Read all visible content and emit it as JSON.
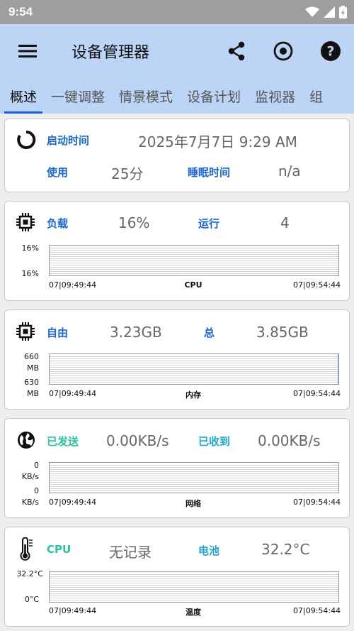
{
  "status": {
    "time": "9:54"
  },
  "app": {
    "title": "设备管理器"
  },
  "tabs": [
    {
      "label": "概述",
      "active": true
    },
    {
      "label": "一键调整"
    },
    {
      "label": "情景模式"
    },
    {
      "label": "设备计划"
    },
    {
      "label": "监视器"
    },
    {
      "label": "组"
    }
  ],
  "uptime": {
    "boot_label": "启动时间",
    "boot_value": "2025年7月7日 9:29 AM",
    "used_label": "使用",
    "used_value": "25分",
    "sleep_label": "睡眠时间",
    "sleep_value": "n/a"
  },
  "cpu": {
    "load_label": "负载",
    "load_value": "16%",
    "run_label": "运行",
    "run_value": "4",
    "axis_top": "16%",
    "axis_bottom": "16%",
    "time_start": "07|09:49:44",
    "time_end": "07|09:54:44",
    "chart_name": "CPU"
  },
  "memory": {
    "free_label": "自由",
    "free_value": "3.23GB",
    "total_label": "总",
    "total_value": "3.85GB",
    "axis_top": "660\nMB",
    "axis_bottom": "630\nMB",
    "time_start": "07|09:49:44",
    "time_end": "07|09:54:44",
    "chart_name": "内存"
  },
  "network": {
    "sent_label": "已发送",
    "sent_value": "0.00KB/s",
    "recv_label": "已收到",
    "recv_value": "0.00KB/s",
    "axis_top": "0\nKB/s",
    "axis_bottom": "0\nKB/s",
    "time_start": "07|09:49:44",
    "time_end": "07|09:54:44",
    "chart_name": "网络"
  },
  "temperature": {
    "cpu_label": "CPU",
    "cpu_value": "无记录",
    "battery_label": "电池",
    "battery_value": "32.2°C",
    "axis_top": "32.2°C",
    "axis_bottom": "0°C",
    "time_start": "07|09:49:44",
    "time_end": "07|09:54:44",
    "chart_name": "温度"
  },
  "colors": {
    "app_bar": "#bcd5f6",
    "accent": "#1a66d0",
    "green": "#27c39c",
    "cyan": "#1fa6cf"
  }
}
